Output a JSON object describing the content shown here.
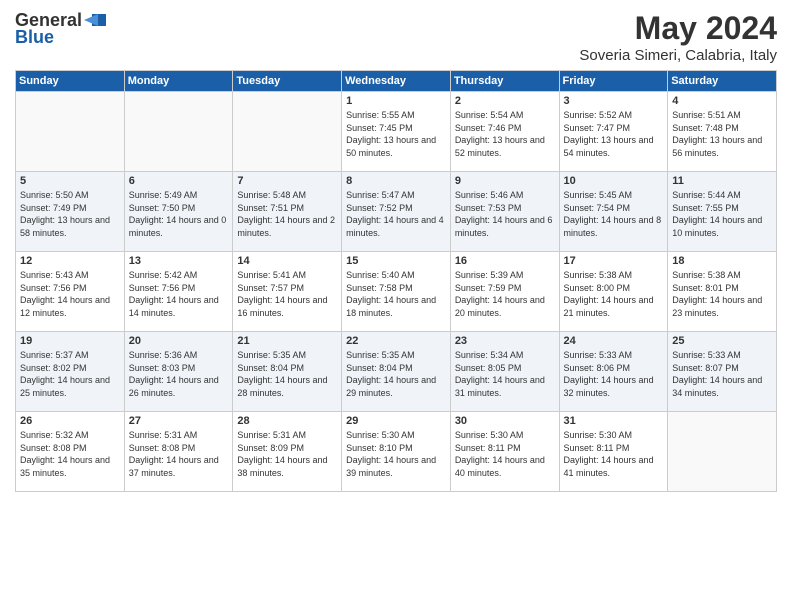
{
  "logo": {
    "general": "General",
    "blue": "Blue"
  },
  "header": {
    "month": "May 2024",
    "location": "Soveria Simeri, Calabria, Italy"
  },
  "weekdays": [
    "Sunday",
    "Monday",
    "Tuesday",
    "Wednesday",
    "Thursday",
    "Friday",
    "Saturday"
  ],
  "weeks": [
    [
      {
        "day": "",
        "sunrise": "",
        "sunset": "",
        "daylight": ""
      },
      {
        "day": "",
        "sunrise": "",
        "sunset": "",
        "daylight": ""
      },
      {
        "day": "",
        "sunrise": "",
        "sunset": "",
        "daylight": ""
      },
      {
        "day": "1",
        "sunrise": "Sunrise: 5:55 AM",
        "sunset": "Sunset: 7:45 PM",
        "daylight": "Daylight: 13 hours and 50 minutes."
      },
      {
        "day": "2",
        "sunrise": "Sunrise: 5:54 AM",
        "sunset": "Sunset: 7:46 PM",
        "daylight": "Daylight: 13 hours and 52 minutes."
      },
      {
        "day": "3",
        "sunrise": "Sunrise: 5:52 AM",
        "sunset": "Sunset: 7:47 PM",
        "daylight": "Daylight: 13 hours and 54 minutes."
      },
      {
        "day": "4",
        "sunrise": "Sunrise: 5:51 AM",
        "sunset": "Sunset: 7:48 PM",
        "daylight": "Daylight: 13 hours and 56 minutes."
      }
    ],
    [
      {
        "day": "5",
        "sunrise": "Sunrise: 5:50 AM",
        "sunset": "Sunset: 7:49 PM",
        "daylight": "Daylight: 13 hours and 58 minutes."
      },
      {
        "day": "6",
        "sunrise": "Sunrise: 5:49 AM",
        "sunset": "Sunset: 7:50 PM",
        "daylight": "Daylight: 14 hours and 0 minutes."
      },
      {
        "day": "7",
        "sunrise": "Sunrise: 5:48 AM",
        "sunset": "Sunset: 7:51 PM",
        "daylight": "Daylight: 14 hours and 2 minutes."
      },
      {
        "day": "8",
        "sunrise": "Sunrise: 5:47 AM",
        "sunset": "Sunset: 7:52 PM",
        "daylight": "Daylight: 14 hours and 4 minutes."
      },
      {
        "day": "9",
        "sunrise": "Sunrise: 5:46 AM",
        "sunset": "Sunset: 7:53 PM",
        "daylight": "Daylight: 14 hours and 6 minutes."
      },
      {
        "day": "10",
        "sunrise": "Sunrise: 5:45 AM",
        "sunset": "Sunset: 7:54 PM",
        "daylight": "Daylight: 14 hours and 8 minutes."
      },
      {
        "day": "11",
        "sunrise": "Sunrise: 5:44 AM",
        "sunset": "Sunset: 7:55 PM",
        "daylight": "Daylight: 14 hours and 10 minutes."
      }
    ],
    [
      {
        "day": "12",
        "sunrise": "Sunrise: 5:43 AM",
        "sunset": "Sunset: 7:56 PM",
        "daylight": "Daylight: 14 hours and 12 minutes."
      },
      {
        "day": "13",
        "sunrise": "Sunrise: 5:42 AM",
        "sunset": "Sunset: 7:56 PM",
        "daylight": "Daylight: 14 hours and 14 minutes."
      },
      {
        "day": "14",
        "sunrise": "Sunrise: 5:41 AM",
        "sunset": "Sunset: 7:57 PM",
        "daylight": "Daylight: 14 hours and 16 minutes."
      },
      {
        "day": "15",
        "sunrise": "Sunrise: 5:40 AM",
        "sunset": "Sunset: 7:58 PM",
        "daylight": "Daylight: 14 hours and 18 minutes."
      },
      {
        "day": "16",
        "sunrise": "Sunrise: 5:39 AM",
        "sunset": "Sunset: 7:59 PM",
        "daylight": "Daylight: 14 hours and 20 minutes."
      },
      {
        "day": "17",
        "sunrise": "Sunrise: 5:38 AM",
        "sunset": "Sunset: 8:00 PM",
        "daylight": "Daylight: 14 hours and 21 minutes."
      },
      {
        "day": "18",
        "sunrise": "Sunrise: 5:38 AM",
        "sunset": "Sunset: 8:01 PM",
        "daylight": "Daylight: 14 hours and 23 minutes."
      }
    ],
    [
      {
        "day": "19",
        "sunrise": "Sunrise: 5:37 AM",
        "sunset": "Sunset: 8:02 PM",
        "daylight": "Daylight: 14 hours and 25 minutes."
      },
      {
        "day": "20",
        "sunrise": "Sunrise: 5:36 AM",
        "sunset": "Sunset: 8:03 PM",
        "daylight": "Daylight: 14 hours and 26 minutes."
      },
      {
        "day": "21",
        "sunrise": "Sunrise: 5:35 AM",
        "sunset": "Sunset: 8:04 PM",
        "daylight": "Daylight: 14 hours and 28 minutes."
      },
      {
        "day": "22",
        "sunrise": "Sunrise: 5:35 AM",
        "sunset": "Sunset: 8:04 PM",
        "daylight": "Daylight: 14 hours and 29 minutes."
      },
      {
        "day": "23",
        "sunrise": "Sunrise: 5:34 AM",
        "sunset": "Sunset: 8:05 PM",
        "daylight": "Daylight: 14 hours and 31 minutes."
      },
      {
        "day": "24",
        "sunrise": "Sunrise: 5:33 AM",
        "sunset": "Sunset: 8:06 PM",
        "daylight": "Daylight: 14 hours and 32 minutes."
      },
      {
        "day": "25",
        "sunrise": "Sunrise: 5:33 AM",
        "sunset": "Sunset: 8:07 PM",
        "daylight": "Daylight: 14 hours and 34 minutes."
      }
    ],
    [
      {
        "day": "26",
        "sunrise": "Sunrise: 5:32 AM",
        "sunset": "Sunset: 8:08 PM",
        "daylight": "Daylight: 14 hours and 35 minutes."
      },
      {
        "day": "27",
        "sunrise": "Sunrise: 5:31 AM",
        "sunset": "Sunset: 8:08 PM",
        "daylight": "Daylight: 14 hours and 37 minutes."
      },
      {
        "day": "28",
        "sunrise": "Sunrise: 5:31 AM",
        "sunset": "Sunset: 8:09 PM",
        "daylight": "Daylight: 14 hours and 38 minutes."
      },
      {
        "day": "29",
        "sunrise": "Sunrise: 5:30 AM",
        "sunset": "Sunset: 8:10 PM",
        "daylight": "Daylight: 14 hours and 39 minutes."
      },
      {
        "day": "30",
        "sunrise": "Sunrise: 5:30 AM",
        "sunset": "Sunset: 8:11 PM",
        "daylight": "Daylight: 14 hours and 40 minutes."
      },
      {
        "day": "31",
        "sunrise": "Sunrise: 5:30 AM",
        "sunset": "Sunset: 8:11 PM",
        "daylight": "Daylight: 14 hours and 41 minutes."
      },
      {
        "day": "",
        "sunrise": "",
        "sunset": "",
        "daylight": ""
      }
    ]
  ]
}
